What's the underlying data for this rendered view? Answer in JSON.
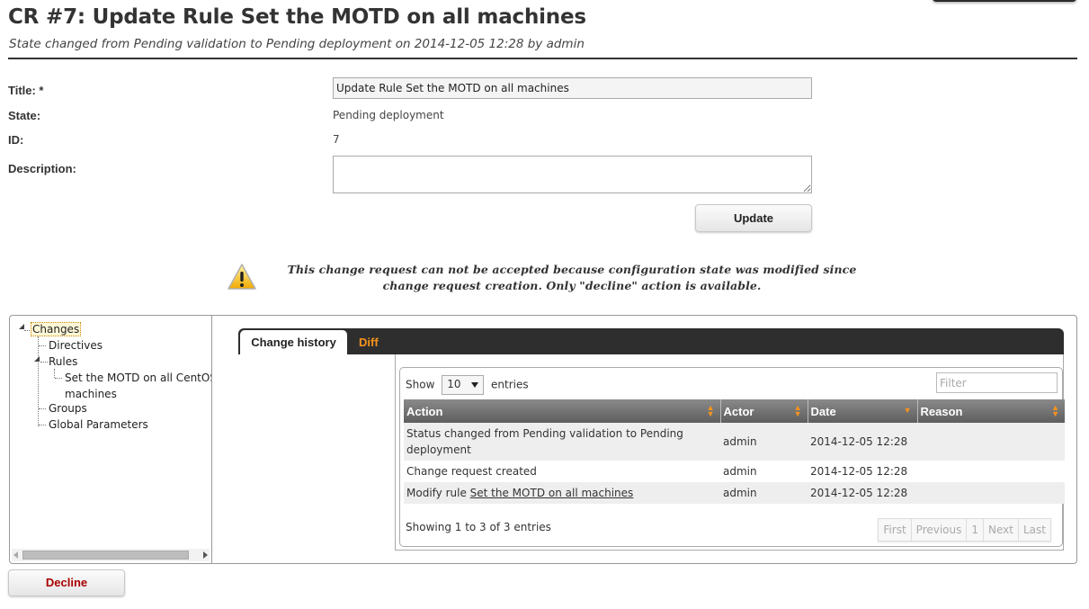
{
  "header": {
    "title": "CR #7: Update Rule Set the MOTD on all machines",
    "subtitle": "State changed from Pending validation to Pending deployment on 2014-12-05 12:28 by admin"
  },
  "form": {
    "title_label": "Title: *",
    "title_value": "Update Rule Set the MOTD on all machines",
    "state_label": "State:",
    "state_value": "Pending deployment",
    "id_label": "ID:",
    "id_value": "7",
    "description_label": "Description:",
    "description_value": "",
    "update_button": "Update"
  },
  "warning": {
    "icon": "warning-icon",
    "message": "This change request can not be accepted because configuration state was modified since change request creation. Only \"decline\" action is available."
  },
  "tree": {
    "root": "Changes",
    "items": [
      {
        "label": "Directives"
      },
      {
        "label": "Rules",
        "children": [
          {
            "label": "Set the MOTD on all CentOS",
            "label2": "machines"
          }
        ]
      },
      {
        "label": "Groups"
      },
      {
        "label": "Global Parameters"
      }
    ]
  },
  "tabs": [
    {
      "label": "Change history",
      "active": true
    },
    {
      "label": "Diff",
      "active": false
    }
  ],
  "table": {
    "show_label": "Show",
    "entries_label": "entries",
    "page_size": "10",
    "filter_placeholder": "Filter",
    "columns": [
      "Action",
      "Actor",
      "Date",
      "Reason"
    ],
    "rows": [
      {
        "action": "Status changed from Pending validation to Pending deployment",
        "actor": "admin",
        "date": "2014-12-05 12:28",
        "reason": ""
      },
      {
        "action": "Change request created",
        "actor": "admin",
        "date": "2014-12-05 12:28",
        "reason": ""
      },
      {
        "action_prefix": "Modify rule ",
        "action_link": "Set the MOTD on all machines",
        "actor": "admin",
        "date": "2014-12-05 12:28",
        "reason": ""
      }
    ],
    "info": "Showing 1 to 3 of 3 entries",
    "pagination": [
      "First",
      "Previous",
      "1",
      "Next",
      "Last"
    ]
  },
  "actions": {
    "decline_button": "Decline"
  },
  "colors": {
    "accent": "#f7941d",
    "decline": "#aa0000",
    "tabbar": "#2e2e2e"
  }
}
